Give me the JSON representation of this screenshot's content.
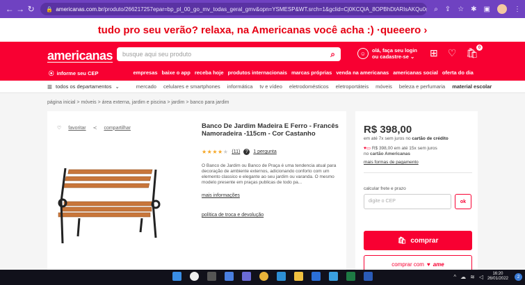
{
  "browser": {
    "url_domain": "americanas.com.br",
    "url_rest": "/produto/266217257epar=bp_pl_00_go_mv_todas_geral_gmv&opn=YSMESP&WT.srch=1&gclid=Cj0KCQiA_8OPBhDtARIsAKQu0gZzrCdXj..."
  },
  "promo": {
    "text": "tudo pro seu verão? relaxa, na Americanas você acha :) · ",
    "link": "queeero",
    "arrow": "›"
  },
  "header": {
    "logo": "americanas",
    "search_placeholder": "busque aqui seu produto",
    "login_line1": "olá, faça seu login",
    "login_line2": "ou cadastre-se ⌄",
    "cart_count": "0",
    "cep": "informe seu CEP",
    "menu": [
      "empresas",
      "baixe o app",
      "receba hoje",
      "produtos internacionais",
      "marcas próprias",
      "venda na americanas",
      "americanas social",
      "oferta do dia"
    ]
  },
  "departments": {
    "label": "todos os departamentos",
    "links": [
      "mercado",
      "celulares e smartphones",
      "informática",
      "tv e vídeo",
      "eletrodomésticos",
      "eletroportáteis",
      "móveis",
      "beleza e perfumaria",
      "material escolar"
    ]
  },
  "breadcrumb": "página inicial  >  móveis  >  área externa, jardim e piscina  >  jardim  >  banco para jardim",
  "product": {
    "favoritar": "favoritar",
    "compartilhar": "compartilhar",
    "title": "Banco De Jardim Madeira E Ferro - Francês Namoradeira -115cm - Cor Castanho",
    "rating": 4,
    "rating_count": "(11)",
    "questions": "1 pergunta",
    "description": "O Banco  de Jardim ou Banco de Praça é uma tendencia atual para decoração de ambiente externos, adicionando conforto com um elemento classico e elegante ao seu jardim ou varanda. O mesmo modelo presente em praças publicas de todo pa...",
    "more_info": "mais informações",
    "exchange": "política de troca e devolução"
  },
  "purchase": {
    "price": "R$ 398,00",
    "installments": "em até 7x sem juros no ",
    "installments_bold": "cartão de crédito",
    "ame_text": "R$ 398,00 em até 15x sem juros",
    "ame_text2": "no ",
    "ame_card": "cartão Americanas",
    "more_payment": "mais formas de pagamento",
    "shipping_label": "calcular frete e prazo",
    "cep_placeholder": "digite o CEP",
    "ok": "ok",
    "buy": "comprar",
    "buy_with": "comprar com",
    "ame": "ame"
  },
  "taskbar": {
    "time": "16:20",
    "date": "26/01/2022"
  },
  "colors": {
    "brand_red": "#f80032",
    "browser_purple": "#6f42c1",
    "star": "#f5a623"
  }
}
